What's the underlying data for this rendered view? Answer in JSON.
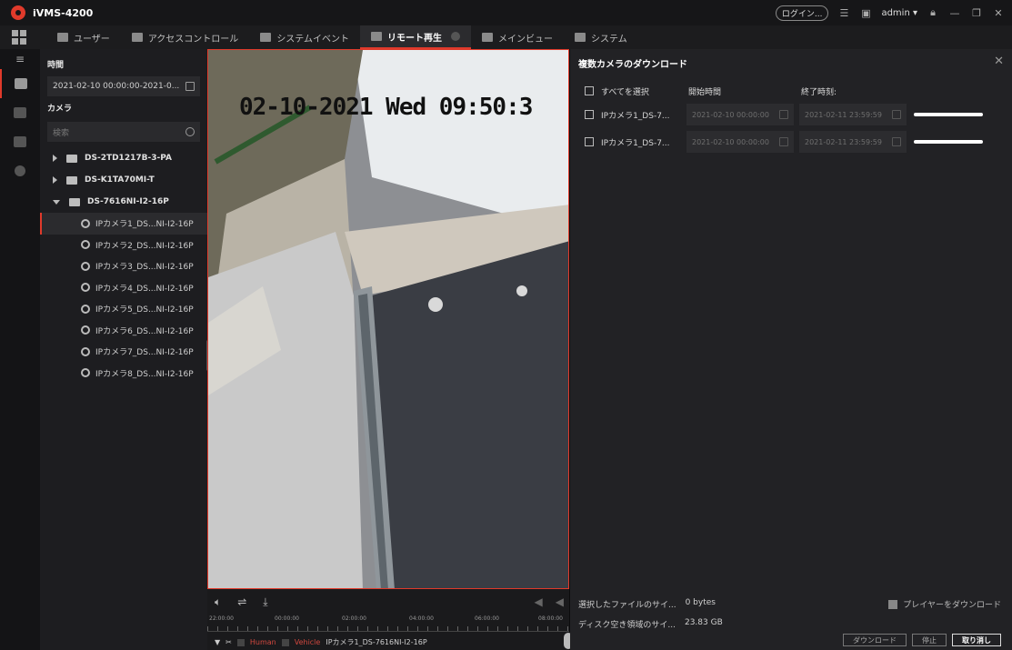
{
  "app": {
    "title": "iVMS-4200"
  },
  "titlebar": {
    "login_label": "ログイン...",
    "user": "admin"
  },
  "tabs": [
    {
      "label": "ユーザー"
    },
    {
      "label": "アクセスコントロール"
    },
    {
      "label": "システムイベント"
    },
    {
      "label": "リモート再生",
      "active": true
    },
    {
      "label": "メインビュー"
    },
    {
      "label": "システム"
    }
  ],
  "left_panel": {
    "time_label": "時間",
    "time_value": "2021-02-10 00:00:00-2021-0...",
    "camera_label": "カメラ",
    "search_placeholder": "検索",
    "devices": [
      {
        "name": "DS-2TD1217B-3-PA",
        "expanded": false
      },
      {
        "name": "DS-K1TA70MI-T",
        "expanded": false
      },
      {
        "name": "DS-7616NI-I2-16P",
        "expanded": true
      }
    ],
    "cameras": [
      "IPカメラ1_DS...NI-I2-16P",
      "IPカメラ2_DS...NI-I2-16P",
      "IPカメラ3_DS...NI-I2-16P",
      "IPカメラ4_DS...NI-I2-16P",
      "IPカメラ5_DS...NI-I2-16P",
      "IPカメラ6_DS...NI-I2-16P",
      "IPカメラ7_DS...NI-I2-16P",
      "IPカメラ8_DS...NI-I2-16P"
    ]
  },
  "video": {
    "osd_text": "02-10-2021 Wed 09:50:3"
  },
  "playback": {
    "timeline_labels": [
      "22:00:00",
      "00:00:00",
      "02:00:00",
      "04:00:00",
      "06:00:00",
      "08:00:00"
    ],
    "filter_human": "Human",
    "filter_vehicle": "Vehicle",
    "camera_name": "IPカメラ1_DS-7616NI-I2-16P"
  },
  "dialog": {
    "title": "複数カメラのダウンロード",
    "select_all": "すべてを選択",
    "start_header": "開始時間",
    "end_header": "終了時刻:",
    "rows": [
      {
        "name": "IPカメラ1_DS-7...",
        "start": "2021-02-10 00:00:00",
        "end": "2021-02-11 23:59:59"
      },
      {
        "name": "IPカメラ1_DS-7...",
        "start": "2021-02-10 00:00:00",
        "end": "2021-02-11 23:59:59"
      }
    ],
    "selected_size_label": "選択したファイルのサイ...",
    "selected_size_value": "0 bytes",
    "disk_space_label": "ディスク空き領域のサイ...",
    "disk_space_value": "23.83 GB",
    "player_download": "プレイヤーをダウンロード",
    "download_btn": "ダウンロード",
    "stop_btn": "停止",
    "cancel_btn": "取り消し"
  },
  "colors": {
    "accent": "#e03a2b",
    "background": "#1d1d20"
  }
}
